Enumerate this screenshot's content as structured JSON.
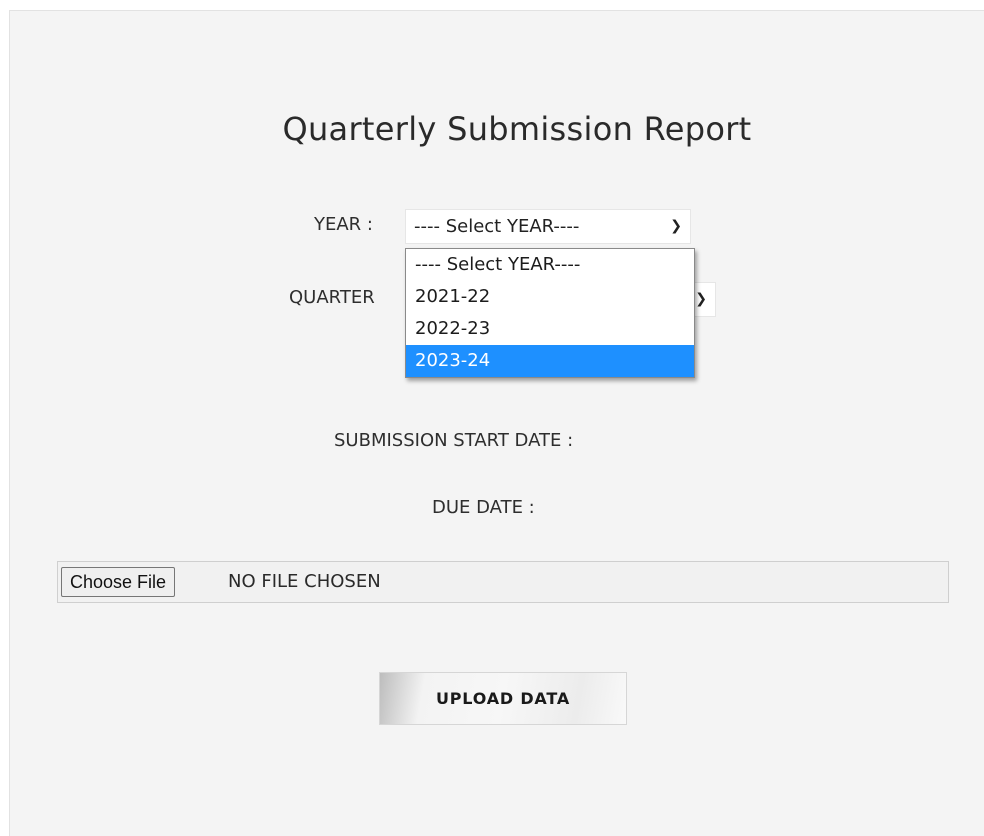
{
  "page": {
    "title": "Quarterly Submission Report"
  },
  "year": {
    "label": "YEAR :",
    "selected": "---- Select YEAR----",
    "options": [
      "---- Select YEAR----",
      "2021-22",
      "2022-23",
      "2023-24"
    ],
    "highlighted_option": "2023-24"
  },
  "quarter": {
    "label": "QUARTER"
  },
  "dates": {
    "start_label": "SUBMISSION START DATE :",
    "due_label": "DUE DATE :"
  },
  "file": {
    "button_label": "Choose File",
    "status": "NO FILE CHOSEN"
  },
  "upload": {
    "label": "UPLOAD DATA"
  },
  "colors": {
    "panel_bg": "#f4f4f4",
    "highlight": "#1e90ff"
  },
  "icons": {
    "dropdown": "chevron-down-icon"
  }
}
